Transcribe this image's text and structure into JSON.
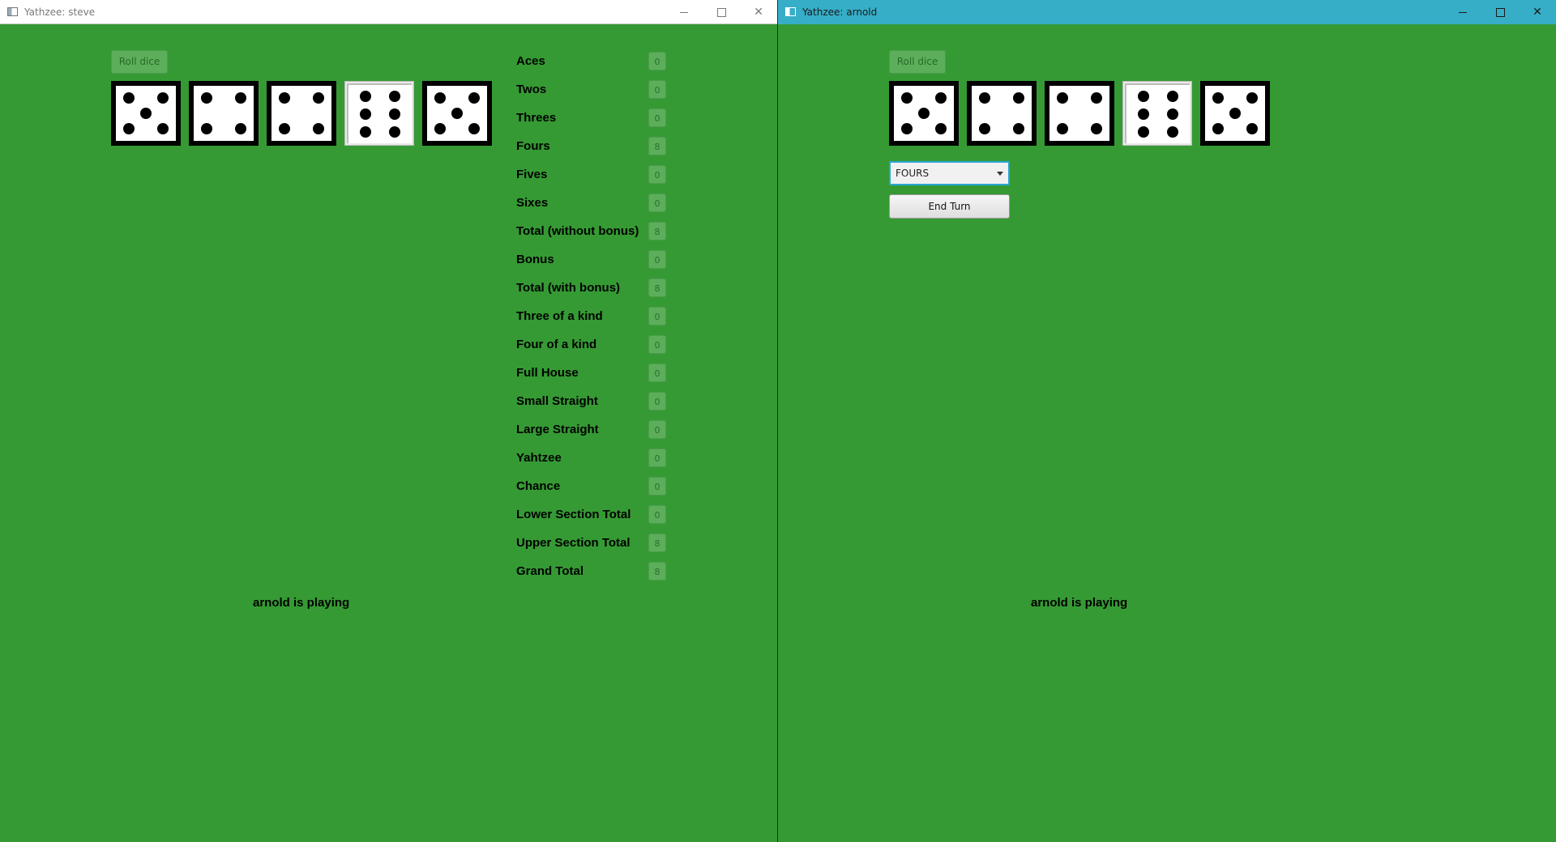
{
  "windows": {
    "left": {
      "title": "Yathzee: steve"
    },
    "right": {
      "title": "Yathzee: arnold"
    }
  },
  "controls": {
    "roll_dice": "Roll dice",
    "category_select": "FOURS",
    "end_turn": "End Turn"
  },
  "dice": [
    5,
    4,
    4,
    6,
    5
  ],
  "held_dice": [
    false,
    false,
    false,
    true,
    false
  ],
  "scorecard": [
    {
      "label": "Aces",
      "value": "0"
    },
    {
      "label": "Twos",
      "value": "0"
    },
    {
      "label": "Threes",
      "value": "0"
    },
    {
      "label": "Fours",
      "value": "8"
    },
    {
      "label": "Fives",
      "value": "0"
    },
    {
      "label": "Sixes",
      "value": "0"
    },
    {
      "label": "Total (without bonus)",
      "value": "8"
    },
    {
      "label": "Bonus",
      "value": "0"
    },
    {
      "label": "Total (with bonus)",
      "value": "8"
    },
    {
      "label": "Three of a kind",
      "value": "0"
    },
    {
      "label": "Four of a kind",
      "value": "0"
    },
    {
      "label": "Full House",
      "value": "0"
    },
    {
      "label": "Small Straight",
      "value": "0"
    },
    {
      "label": "Large Straight",
      "value": "0"
    },
    {
      "label": "Yahtzee",
      "value": "0"
    },
    {
      "label": "Chance",
      "value": "0"
    },
    {
      "label": "Lower Section Total",
      "value": "0"
    },
    {
      "label": "Upper Section Total",
      "value": "8"
    },
    {
      "label": "Grand Total",
      "value": "8"
    }
  ],
  "status": "arnold is playing",
  "colors": {
    "background": "#359a34",
    "active_titlebar": "#36aec8",
    "disabled_button": "#5cae5b"
  },
  "icons": {
    "minimize": "minimize-icon",
    "maximize": "maximize-icon",
    "close": "close-icon"
  }
}
